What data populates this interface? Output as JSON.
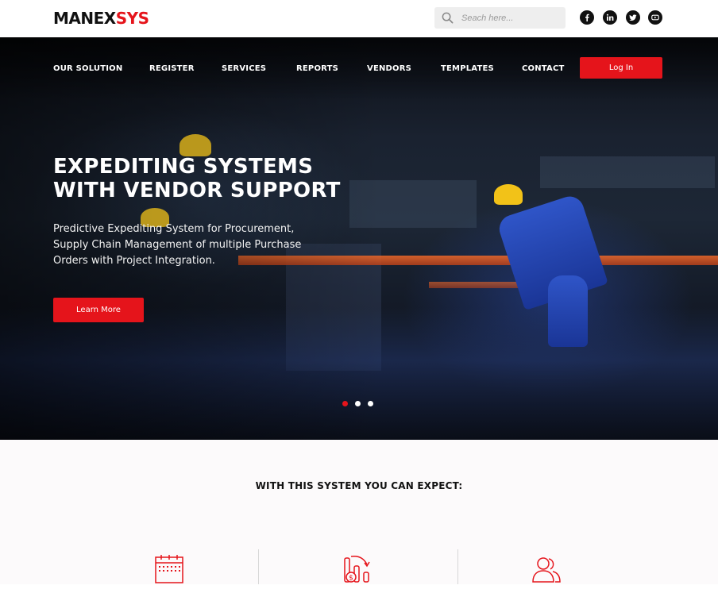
{
  "brand": {
    "logo_part1": "MANEX",
    "logo_part2": "SYS"
  },
  "search": {
    "placeholder": "Seach here..."
  },
  "social": [
    "facebook-icon",
    "linkedin-icon",
    "twitter-icon",
    "youtube-icon"
  ],
  "nav": {
    "items": [
      "OUR SOLUTION",
      "REGISTER",
      "SERVICES",
      "REPORTS",
      "VENDORS",
      "TEMPLATES",
      "CONTACT"
    ],
    "login_label": "Log In"
  },
  "hero": {
    "headline_line1": "EXPEDITING SYSTEMS",
    "headline_line2": "WITH VENDOR SUPPORT",
    "sub_line1": "Predictive Expediting System for Procurement,",
    "sub_line2": "Supply Chain Management of multiple Purchase",
    "sub_line3": "Orders with Project Integration.",
    "cta_label": "Learn More",
    "slides": 3,
    "active_slide": 1
  },
  "features": {
    "heading": "WITH THIS SYSTEM YOU CAN EXPECT:",
    "icons": [
      "calendar-icon",
      "cost-reduction-icon",
      "users-icon"
    ]
  },
  "colors": {
    "accent": "#e5141b",
    "dark": "#111111"
  }
}
